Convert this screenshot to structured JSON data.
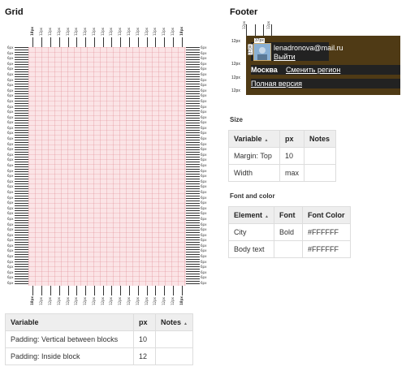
{
  "grid_section": {
    "title": "Grid",
    "col_label": "12px",
    "col_label_bold": "18px",
    "row_label": "6px",
    "table": {
      "headers": [
        "Variable",
        "px",
        "Notes"
      ],
      "rows": [
        [
          "Padding: Vertical between blocks",
          "10",
          ""
        ],
        [
          "Padding: Inside block",
          "12",
          ""
        ]
      ]
    }
  },
  "footer_section": {
    "title": "Footer",
    "email": "lenadronova@mail.ru",
    "logout": "Выйти",
    "city": "Москва",
    "change_region": "Сменить регион",
    "full_version": "Полная версия",
    "spacing": {
      "p12": "12px",
      "p37": "37px"
    }
  },
  "size_section": {
    "title": "Size",
    "table": {
      "headers": [
        "Variable",
        "px",
        "Notes"
      ],
      "rows": [
        [
          "Margin: Top",
          "10",
          ""
        ],
        [
          "Width",
          "max",
          ""
        ]
      ]
    }
  },
  "font_section": {
    "title": "Font and color",
    "table": {
      "headers": [
        "Element",
        "Font",
        "Font Color"
      ],
      "rows": [
        [
          "City",
          "Bold",
          "#FFFFFF"
        ],
        [
          "Body text",
          "",
          "#FFFFFF"
        ]
      ]
    }
  },
  "colors": {
    "grid_pink": "#fbe4e6",
    "footer_bg": "#222222",
    "footer_band": "#4f3a15",
    "avatar_border": "#c9a96e"
  }
}
